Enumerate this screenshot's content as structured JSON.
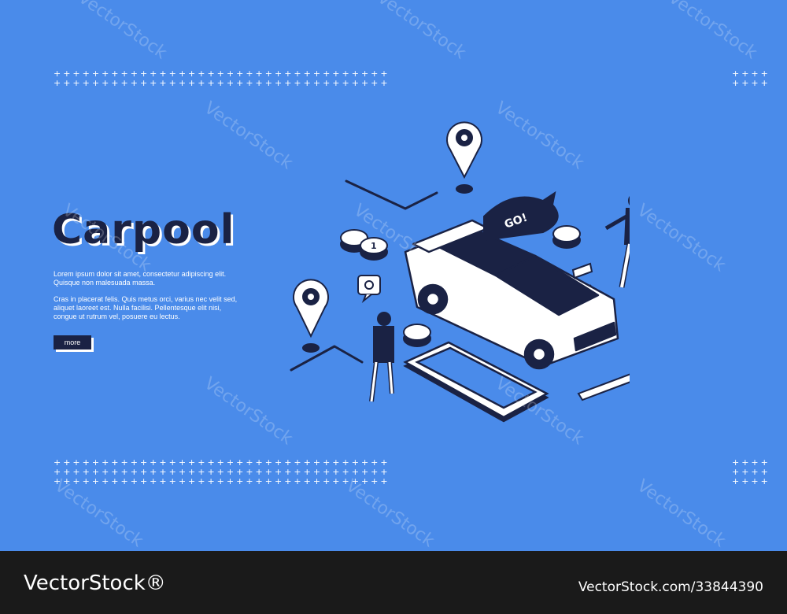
{
  "hero": {
    "title": "Carpool",
    "paragraph1": "Lorem ipsum dolor sit amet, consectetur adipiscing elit. Quisque non malesuada massa.",
    "paragraph2": "Cras in placerat felis. Quis metus orci, varius nec velit sed, aliquet laoreet est. Nulla facilisi. Pellentesque elit nisi, congue ut rutrum vel, posuere eu lectus.",
    "more_label": "more"
  },
  "illustration": {
    "bubble_text": "GO!",
    "coin_label": "1"
  },
  "decor": {
    "dots_row": "+++++++++++++++++++++++++++++++++++",
    "dots_short": "++++"
  },
  "watermark": {
    "text": "VectorStock"
  },
  "footer": {
    "logo": "VectorStock®",
    "image_id": "VectorStock.com/33844390"
  },
  "colors": {
    "background": "#4A8BEA",
    "dark": "#1a2244",
    "footer": "#1a1a1a"
  }
}
